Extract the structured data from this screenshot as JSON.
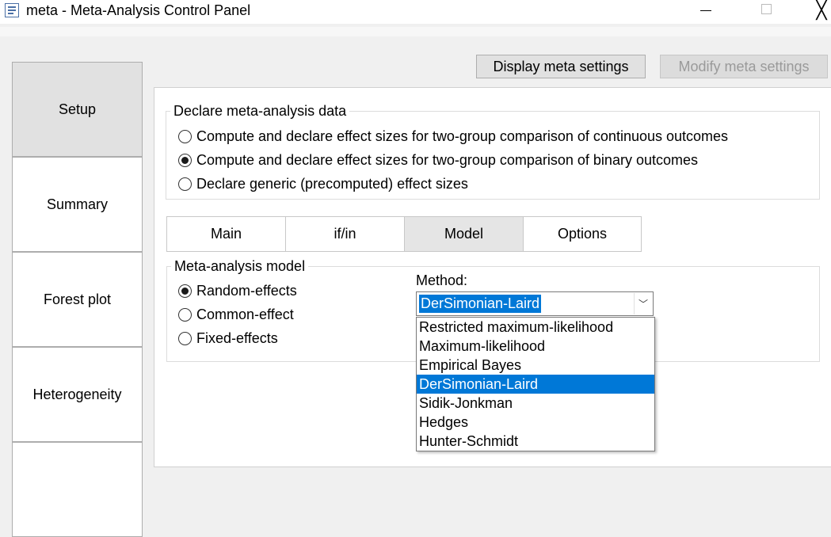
{
  "window": {
    "title": "meta - Meta-Analysis Control Panel",
    "icons": {
      "app": "table-icon",
      "minimize": "minimize-icon",
      "maximize": "maximize-icon",
      "close": "close-icon"
    },
    "close_glyph": "╳"
  },
  "sidebar": {
    "items": [
      {
        "label": "Setup",
        "active": true
      },
      {
        "label": "Summary",
        "active": false
      },
      {
        "label": "Forest plot",
        "active": false
      },
      {
        "label": "Heterogeneity",
        "active": false
      }
    ]
  },
  "toolbar": {
    "display_label": "Display meta settings",
    "modify_label": "Modify meta settings",
    "modify_enabled": false
  },
  "declare": {
    "legend": "Declare meta-analysis data",
    "options": [
      {
        "label": "Compute and declare effect sizes for two-group comparison of continuous outcomes",
        "checked": false
      },
      {
        "label": "Compute and declare effect sizes for two-group comparison of binary outcomes",
        "checked": true
      },
      {
        "label": "Declare generic (precomputed) effect sizes",
        "checked": false
      }
    ]
  },
  "tabs": [
    {
      "label": "Main",
      "active": false
    },
    {
      "label": "if/in",
      "active": false
    },
    {
      "label": "Model",
      "active": true
    },
    {
      "label": "Options",
      "active": false
    }
  ],
  "model": {
    "legend": "Meta-analysis model",
    "options": [
      {
        "label": "Random-effects",
        "checked": true
      },
      {
        "label": "Common-effect",
        "checked": false
      },
      {
        "label": "Fixed-effects",
        "checked": false
      }
    ],
    "method": {
      "label": "Method:",
      "value": "DerSimonian-Laird",
      "arrow_glyph": "﹀",
      "options": [
        "Restricted maximum-likelihood",
        "Maximum-likelihood",
        "Empirical Bayes",
        "DerSimonian-Laird",
        "Sidik-Jonkman",
        "Hedges",
        "Hunter-Schmidt"
      ],
      "highlighted": "DerSimonian-Laird"
    }
  },
  "colors": {
    "selection": "#0078d7",
    "active_tab": "#e5e5e5",
    "button": "#e1e1e1"
  }
}
